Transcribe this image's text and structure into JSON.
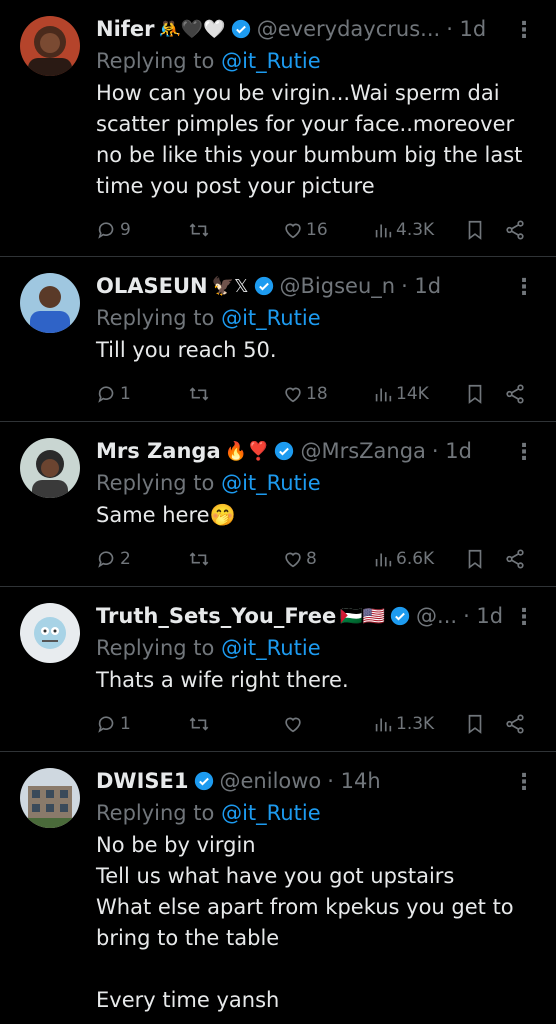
{
  "replying_label": "Replying to",
  "tweets": [
    {
      "name": "Nifer",
      "emoji": "🤼🖤🤍",
      "handle": "@everydaycrus...",
      "time": "· 1d",
      "reply_to": "@it_Rutie",
      "text": "How can you be virgin...Wai sperm dai scatter pimples for your face..moreover no be like this your bumbum big the last time you post your picture",
      "replies": "9",
      "retweets": "",
      "likes": "16",
      "views": "4.3K"
    },
    {
      "name": "OLASEUN",
      "emoji": "🦅𝕏",
      "handle": "@Bigseu_n",
      "time": "· 1d",
      "reply_to": "@it_Rutie",
      "text": "Till you reach 50.",
      "replies": "1",
      "retweets": "",
      "likes": "18",
      "views": "14K"
    },
    {
      "name": "Mrs Zanga",
      "emoji": "🔥❣️",
      "handle": "@MrsZanga",
      "time": "· 1d",
      "reply_to": "@it_Rutie",
      "text": "Same here🤭",
      "replies": "2",
      "retweets": "",
      "likes": "8",
      "views": "6.6K"
    },
    {
      "name": "Truth_Sets_You_Free",
      "emoji": "🇵🇸🇺🇸",
      "handle": "@...",
      "time": "· 1d",
      "reply_to": "@it_Rutie",
      "text": "Thats a wife right there.",
      "replies": "1",
      "retweets": "",
      "likes": "",
      "views": "1.3K"
    },
    {
      "name": "DWISE1",
      "emoji": "",
      "handle": "@enilowo",
      "time": "· 14h",
      "reply_to": "@it_Rutie",
      "text": "No be by virgin\nTell us what have you got upstairs\nWhat else apart from kpekus you get to bring to the table\n\nEvery time yansh"
    }
  ],
  "colors": {
    "background": "#000000",
    "text": "#e7e9ea",
    "muted": "#71767b",
    "accent": "#1d9bf0",
    "divider": "#2f3336"
  }
}
